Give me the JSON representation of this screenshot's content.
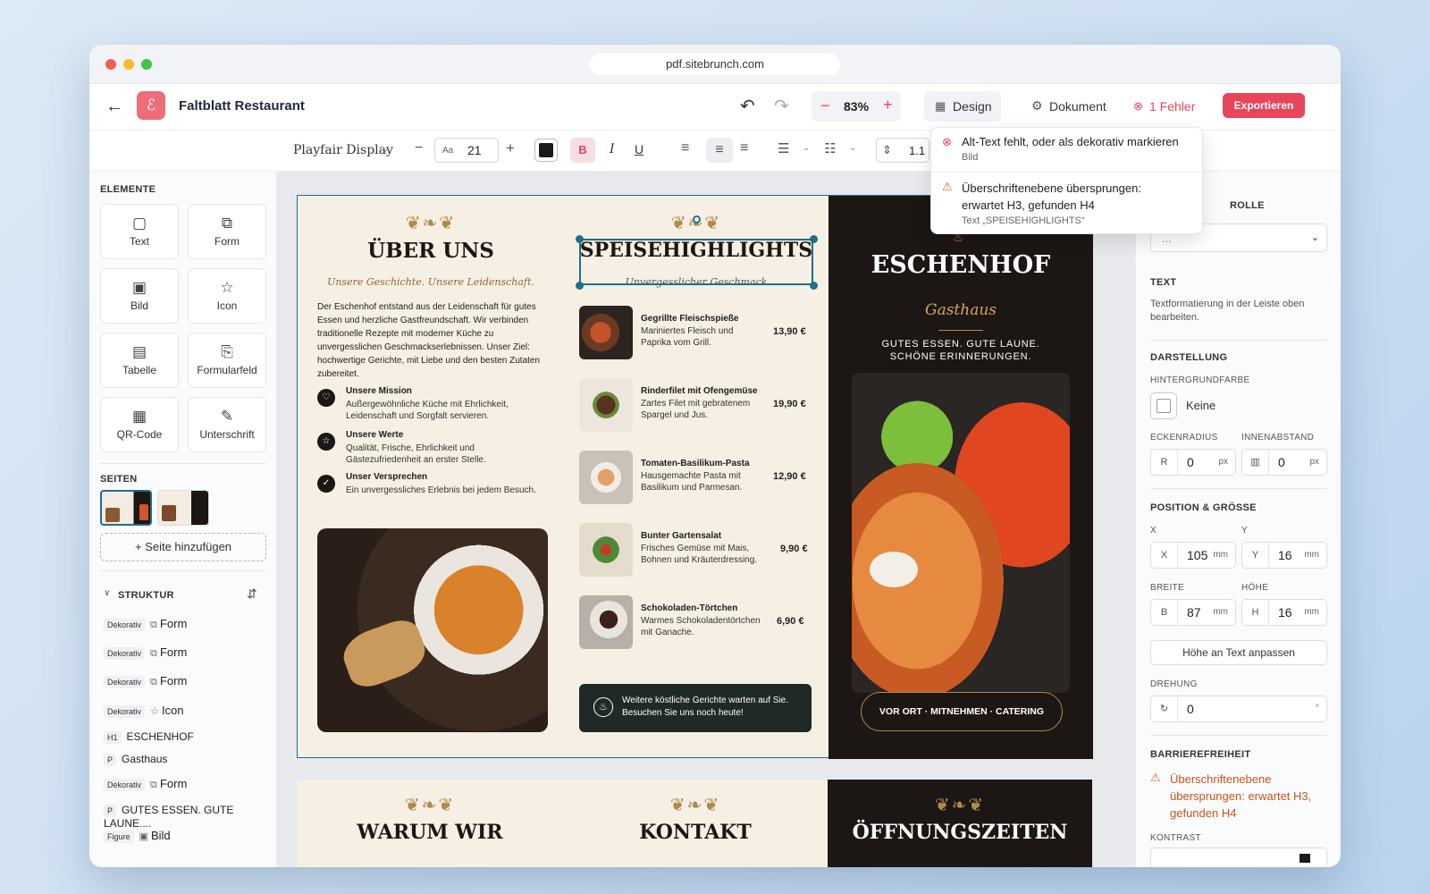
{
  "browser": {
    "url": "pdf.sitebrunch.com"
  },
  "header": {
    "title": "Faltblatt Restaurant",
    "zoom": "83%",
    "design_label": "Design",
    "document_label": "Dokument",
    "error_label": "1 Fehler",
    "export_label": "Exportieren"
  },
  "format_bar": {
    "font": "Playfair Display",
    "size_prefix": "Aa",
    "size": "21",
    "color": "#1a1a1a",
    "bold": "B",
    "italic": "I",
    "underline": "U",
    "line_height": "1.1"
  },
  "issues": [
    {
      "type": "error",
      "title": "Alt-Text fehlt, oder als dekorativ markieren",
      "sub": "Bild"
    },
    {
      "type": "warning",
      "title": "Überschriftenebene übersprungen: erwartet H3, gefunden H4",
      "sub": "Text „SPEISEHIGHLIGHTS“"
    }
  ],
  "left_panel": {
    "elements_heading": "ELEMENTE",
    "elements": [
      {
        "label": "Text",
        "icon": "document-icon"
      },
      {
        "label": "Form",
        "icon": "shape-icon"
      },
      {
        "label": "Bild",
        "icon": "image-icon"
      },
      {
        "label": "Icon",
        "icon": "star-icon"
      },
      {
        "label": "Tabelle",
        "icon": "table-icon"
      },
      {
        "label": "Formularfeld",
        "icon": "form-field-icon"
      },
      {
        "label": "QR-Code",
        "icon": "qr-icon"
      },
      {
        "label": "Unterschrift",
        "icon": "signature-icon"
      }
    ],
    "pages_heading": "SEITEN",
    "add_page": "+ Seite hinzufügen",
    "structure_heading": "STRUKTUR",
    "structure": [
      {
        "tag": "Dekorativ",
        "icon": "shape-icon",
        "label": "Form"
      },
      {
        "tag": "Dekorativ",
        "icon": "shape-icon",
        "label": "Form"
      },
      {
        "tag": "Dekorativ",
        "icon": "shape-icon",
        "label": "Form"
      },
      {
        "tag": "Dekorativ",
        "icon": "star-icon",
        "label": "Icon"
      },
      {
        "tag": "H1",
        "icon": "",
        "label": "ESCHENHOF"
      },
      {
        "tag": "P",
        "icon": "",
        "label": "Gasthaus"
      },
      {
        "tag": "Dekorativ",
        "icon": "shape-icon",
        "label": "Form"
      },
      {
        "tag": "P",
        "icon": "",
        "label": "GUTES ESSEN. GUTE LAUNE...."
      },
      {
        "tag": "Figure",
        "icon": "image-icon",
        "label": "Bild"
      }
    ]
  },
  "right_panel": {
    "role_heading": "ROLLE",
    "role_value": "...",
    "text_heading": "TEXT",
    "text_hint": "Textformatierung in der Leiste oben bearbeiten.",
    "display_heading": "DARSTELLUNG",
    "bg_label": "HINTERGRUNDFARBE",
    "bg_value": "Keine",
    "radius_label": "ECKENRADIUS",
    "radius_prefix": "R",
    "radius_value": "0",
    "padding_label": "INNENABSTAND",
    "padding_value": "0",
    "unit_px": "px",
    "unit_mm": "mm",
    "pos_heading": "POSITION & GRÖSSE",
    "x_label": "X",
    "x_value": "105",
    "y_label": "Y",
    "y_value": "16",
    "w_label": "BREITE",
    "w_prefix": "B",
    "w_value": "87",
    "h_label": "HÖHE",
    "h_prefix": "H",
    "h_value": "16",
    "fit_button": "Höhe an Text anpassen",
    "rotation_label": "DREHUNG",
    "rotation_value": "0",
    "rotation_unit": "°",
    "a11y_heading": "BARRIEREFREIHEIT",
    "a11y_warning": "Überschriftenebene übersprungen: erwartet H3, gefunden H4",
    "contrast_label": "KONTRAST"
  },
  "flyer": {
    "about": {
      "title": "ÜBER UNS",
      "subtitle": "Unsere Geschichte. Unsere Leidenschaft.",
      "body": "Der Eschenhof entstand aus der Leidenschaft für gutes Essen und herzliche Gastfreundschaft. Wir verbinden traditionelle Rezepte mit moderner Küche zu unvergesslichen Geschmackserlebnissen. Unser Ziel: hochwertige Gerichte, mit Liebe und den besten Zutaten zubereitet.",
      "points": [
        {
          "title": "Unsere Mission",
          "text": "Außergewöhnliche Küche mit Ehrlichkeit, Leidenschaft und Sorgfalt servieren.",
          "icon": "heart-icon"
        },
        {
          "title": "Unsere Werte",
          "text": "Qualität, Frische, Ehrlichkeit und Gästezufriedenheit an erster Stelle.",
          "icon": "star-icon"
        },
        {
          "title": "Unser Versprechen",
          "text": "Ein unvergessliches Erlebnis bei jedem Besuch.",
          "icon": "check-icon"
        }
      ]
    },
    "menu": {
      "title": "SPEISEHIGHLIGHTS",
      "subtitle": "Unvergesslicher Geschmack",
      "items": [
        {
          "name": "Gegrillte Fleischspieße",
          "desc": "Mariniertes Fleisch und Paprika vom Grill.",
          "price": "13,90 €"
        },
        {
          "name": "Rinderfilet mit Ofengemüse",
          "desc": "Zartes Filet mit gebratenem Spargel und Jus.",
          "price": "19,90 €"
        },
        {
          "name": "Tomaten-Basilikum-Pasta",
          "desc": "Hausgemachte Pasta mit Basilikum und Parmesan.",
          "price": "12,90 €"
        },
        {
          "name": "Bunter Gartensalat",
          "desc": "Frisches Gemüse mit Mais, Bohnen und Kräuterdressing.",
          "price": "9,90 €"
        },
        {
          "name": "Schokoladen-Törtchen",
          "desc": "Warmes Schokoladentörtchen mit Ganache.",
          "price": "6,90 €"
        }
      ],
      "banner": "Weitere köstliche Gerichte warten auf Sie. Besuchen Sie uns noch heute!"
    },
    "cover": {
      "title": "ESCHENHOF",
      "subtitle": "Gasthaus",
      "tagline1": "GUTES ESSEN. GUTE LAUNE.",
      "tagline2": "SCHÖNE ERINNERUNGEN.",
      "pill": "VOR ORT · MITNEHMEN · CATERING"
    },
    "page2": {
      "col1": "WARUM WIR",
      "col2": "KONTAKT",
      "col3": "ÖFFNUNGSZEITEN"
    }
  },
  "colors": {
    "accent": "#e8455a",
    "selection": "#1e6f8a",
    "cream": "#f6efe3",
    "dark": "#1c1614",
    "gold": "#b08a4a"
  }
}
